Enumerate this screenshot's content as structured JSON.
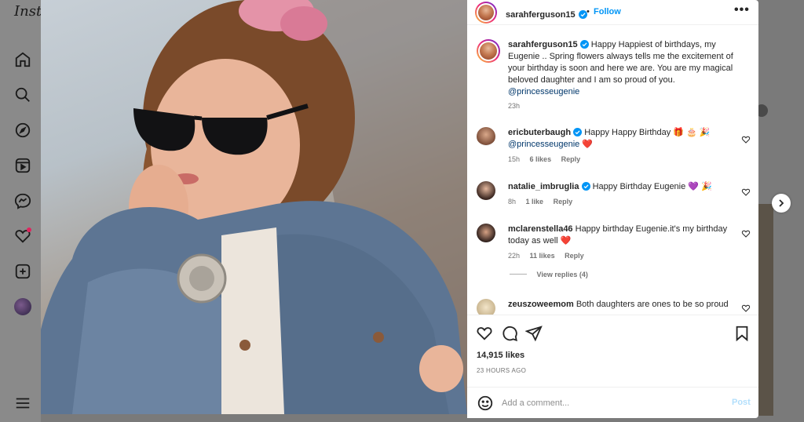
{
  "app": {
    "logo_text": "Inst"
  },
  "post": {
    "author": "sarahferguson15",
    "follow_label": "Follow",
    "separator": "•",
    "more_label": "•••",
    "caption": "Happy Happiest of birthdays, my Eugenie .. Spring flowers always tells me the excitement of your birthday is soon and here we are. You are my magical beloved daughter and I am so proud of you.",
    "caption_mention": "@princesseugenie",
    "caption_time": "23h",
    "likes": "14,915 likes",
    "posted_ago": "23 HOURS AGO"
  },
  "comments": [
    {
      "user": "ericbuterbaugh",
      "verified": true,
      "text": "Happy Happy Birthday 🎁 🎂 🎉",
      "mention": "@princesseugenie",
      "suffix": "❤️",
      "time": "15h",
      "likes": "6 likes",
      "reply": "Reply"
    },
    {
      "user": "natalie_imbruglia",
      "verified": true,
      "text": "Happy Birthday Eugenie 💜 🎉",
      "time": "8h",
      "likes": "1 like",
      "reply": "Reply"
    },
    {
      "user": "mclarenstella46",
      "verified": false,
      "text": "Happy birthday Eugenie.it's my birthday today as well ❤️",
      "time": "22h",
      "likes": "11 likes",
      "reply": "Reply",
      "view_replies": "View replies (4)"
    },
    {
      "user": "zeuszoweemom",
      "verified": false,
      "text": "Both daughters are ones to be so proud"
    }
  ],
  "composer": {
    "placeholder": "Add a comment...",
    "post_label": "Post"
  },
  "icons": {
    "nav": [
      "home-icon",
      "search-icon",
      "explore-icon",
      "reels-icon",
      "messenger-icon",
      "notifications-icon",
      "create-icon",
      "profile-icon",
      "menu-icon"
    ],
    "actions": [
      "like-icon",
      "comment-icon",
      "share-icon",
      "save-icon"
    ]
  },
  "colors": {
    "accent": "#0095f6",
    "verified": "#0095f6",
    "heart": "#ed4956",
    "post_disabled": "#b2dffc"
  }
}
